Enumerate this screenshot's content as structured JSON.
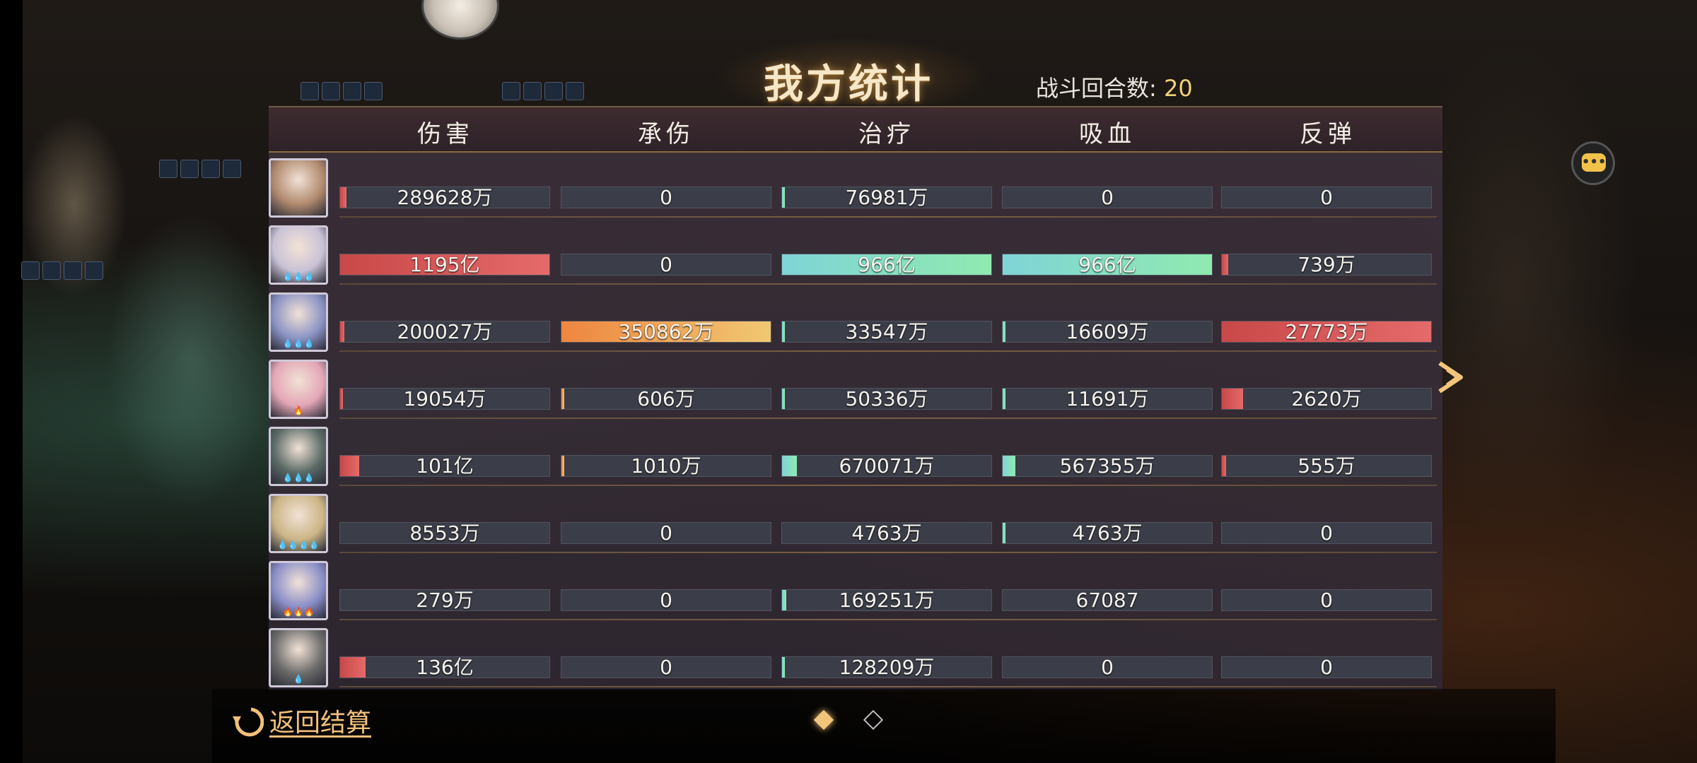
{
  "title": "我方统计",
  "battle_rounds": {
    "label": "战斗回合数:",
    "value": "20"
  },
  "columns": [
    "伤害",
    "承伤",
    "治疗",
    "吸血",
    "反弹"
  ],
  "rows": [
    {
      "stars": "",
      "avatar_color": "#b08a6e",
      "cells": [
        {
          "text": "289628万",
          "fill": 0.03,
          "color": "red"
        },
        {
          "text": "0",
          "fill": 0,
          "color": "orange"
        },
        {
          "text": "76981万",
          "fill": 0.01,
          "color": "cyan"
        },
        {
          "text": "0",
          "fill": 0,
          "color": "cyan"
        },
        {
          "text": "0",
          "fill": 0,
          "color": "red"
        }
      ]
    },
    {
      "stars": "💧💧💧",
      "avatar_color": "#c9c2d6",
      "cells": [
        {
          "text": "1195亿",
          "fill": 1.0,
          "color": "red"
        },
        {
          "text": "0",
          "fill": 0,
          "color": "orange"
        },
        {
          "text": "966亿",
          "fill": 1.0,
          "color": "cyan"
        },
        {
          "text": "966亿",
          "fill": 1.0,
          "color": "cyan"
        },
        {
          "text": "739万",
          "fill": 0.03,
          "color": "red"
        }
      ]
    },
    {
      "stars": "💧💧💧",
      "avatar_color": "#8b93c4",
      "cells": [
        {
          "text": "200027万",
          "fill": 0.02,
          "color": "red"
        },
        {
          "text": "350862万",
          "fill": 1.0,
          "color": "orange"
        },
        {
          "text": "33547万",
          "fill": 0.005,
          "color": "cyan"
        },
        {
          "text": "16609万",
          "fill": 0.005,
          "color": "cyan"
        },
        {
          "text": "27773万",
          "fill": 1.0,
          "color": "red"
        }
      ]
    },
    {
      "stars": "🔥",
      "avatar_color": "#e3a6b6",
      "cells": [
        {
          "text": "19054万",
          "fill": 0.002,
          "color": "red"
        },
        {
          "text": "606万",
          "fill": 0.002,
          "color": "orange"
        },
        {
          "text": "50336万",
          "fill": 0.005,
          "color": "cyan"
        },
        {
          "text": "11691万",
          "fill": 0.003,
          "color": "cyan"
        },
        {
          "text": "2620万",
          "fill": 0.1,
          "color": "red"
        }
      ]
    },
    {
      "stars": "💧💧💧",
      "avatar_color": "#5a6a66",
      "cells": [
        {
          "text": "101亿",
          "fill": 0.09,
          "color": "red"
        },
        {
          "text": "1010万",
          "fill": 0.003,
          "color": "orange"
        },
        {
          "text": "670071万",
          "fill": 0.07,
          "color": "cyan"
        },
        {
          "text": "567355万",
          "fill": 0.06,
          "color": "cyan"
        },
        {
          "text": "555万",
          "fill": 0.02,
          "color": "red"
        }
      ]
    },
    {
      "stars": "💧💧💧💧",
      "avatar_color": "#cbb586",
      "cells": [
        {
          "text": "8553万",
          "fill": 0,
          "color": "red"
        },
        {
          "text": "0",
          "fill": 0,
          "color": "orange"
        },
        {
          "text": "4763万",
          "fill": 0,
          "color": "cyan"
        },
        {
          "text": "4763万",
          "fill": 0.003,
          "color": "cyan"
        },
        {
          "text": "0",
          "fill": 0,
          "color": "red"
        }
      ]
    },
    {
      "stars": "🔥🔥🔥",
      "avatar_color": "#8a8ec8",
      "cells": [
        {
          "text": "279万",
          "fill": 0,
          "color": "red"
        },
        {
          "text": "0",
          "fill": 0,
          "color": "orange"
        },
        {
          "text": "169251万",
          "fill": 0.02,
          "color": "cyan"
        },
        {
          "text": "67087",
          "fill": 0,
          "color": "cyan"
        },
        {
          "text": "0",
          "fill": 0,
          "color": "red"
        }
      ]
    },
    {
      "stars": "💧",
      "avatar_color": "#6b6a6a",
      "cells": [
        {
          "text": "136亿",
          "fill": 0.12,
          "color": "red"
        },
        {
          "text": "0",
          "fill": 0,
          "color": "orange"
        },
        {
          "text": "128209万",
          "fill": 0.01,
          "color": "cyan"
        },
        {
          "text": "0",
          "fill": 0,
          "color": "cyan"
        },
        {
          "text": "0",
          "fill": 0,
          "color": "red"
        }
      ]
    }
  ],
  "back_button": {
    "label": "返回结算"
  },
  "icons": {
    "chat": "chat-bubble-icon",
    "next": "chevron-right-icon",
    "back": "return-arrow-icon"
  },
  "pagination": {
    "current": 1,
    "total": 2
  }
}
